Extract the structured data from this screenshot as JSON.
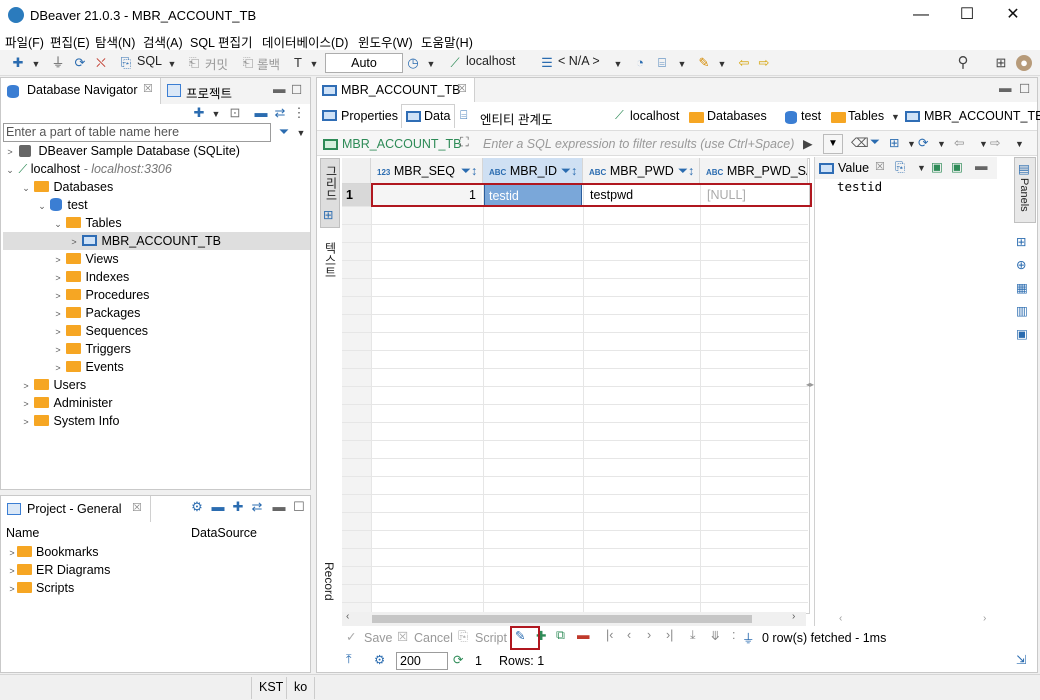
{
  "window": {
    "title": "DBeaver 21.0.3 - MBR_ACCOUNT_TB",
    "minimize": "—",
    "maximize": "☐",
    "close": "✕"
  },
  "menu": [
    "파일(F)",
    "편집(E)",
    "탐색(N)",
    "검색(A)",
    "SQL 편집기",
    "데이터베이스(D)",
    "윈도우(W)",
    "도움말(H)"
  ],
  "toolbar": {
    "sql": "SQL",
    "commit": "커밋",
    "rollback": "롤백",
    "tx_mode": "Auto",
    "connection": "localhost",
    "schema": "< N/A >"
  },
  "navigator": {
    "tab": "Database Navigator",
    "projects_tab": "프로젝트",
    "filter_placeholder": "Enter a part of table name here",
    "tree": {
      "sample": "DBeaver Sample Database (SQLite)",
      "localhost": "localhost",
      "localhost_hint": "- localhost:3306",
      "databases": "Databases",
      "test": "test",
      "tables": "Tables",
      "mbr_account_tb": "MBR_ACCOUNT_TB",
      "views": "Views",
      "indexes": "Indexes",
      "procedures": "Procedures",
      "packages": "Packages",
      "sequences": "Sequences",
      "triggers": "Triggers",
      "events": "Events",
      "users": "Users",
      "administer": "Administer",
      "system_info": "System Info"
    }
  },
  "project": {
    "tab": "Project - General",
    "col_name": "Name",
    "col_datasource": "DataSource",
    "items": [
      "Bookmarks",
      "ER Diagrams",
      "Scripts"
    ]
  },
  "editor": {
    "tab": "MBR_ACCOUNT_TB",
    "subtabs": [
      "Properties",
      "Data",
      "엔티티 관계도"
    ],
    "breadcrumb": [
      "localhost",
      "Databases",
      "test",
      "Tables",
      "MBR_ACCOUNT_TB"
    ],
    "filter_table": "MBR_ACCOUNT_TB",
    "filter_placeholder": "Enter a SQL expression to filter results (use Ctrl+Space)",
    "vtabs": {
      "grid": "그리드",
      "text": "텍스트",
      "record": "Record"
    },
    "columns": [
      "MBR_SEQ",
      "MBR_ID",
      "MBR_PWD",
      "MBR_PWD_SA"
    ],
    "rows": [
      {
        "num": "1",
        "cells": [
          "1",
          "testid",
          "testpwd",
          "[NULL]"
        ]
      }
    ],
    "value_panel": {
      "title": "Value",
      "content": "testid",
      "side_tab": "Panels"
    },
    "actions": {
      "save": "Save",
      "cancel": "Cancel",
      "script": "Script"
    },
    "fetch_status": "0 row(s) fetched - 1ms",
    "fetch_size": "200",
    "refresh_count": "1",
    "rows_label": "Rows: 1"
  },
  "statusbar": {
    "timezone": "KST",
    "locale": "ko"
  }
}
